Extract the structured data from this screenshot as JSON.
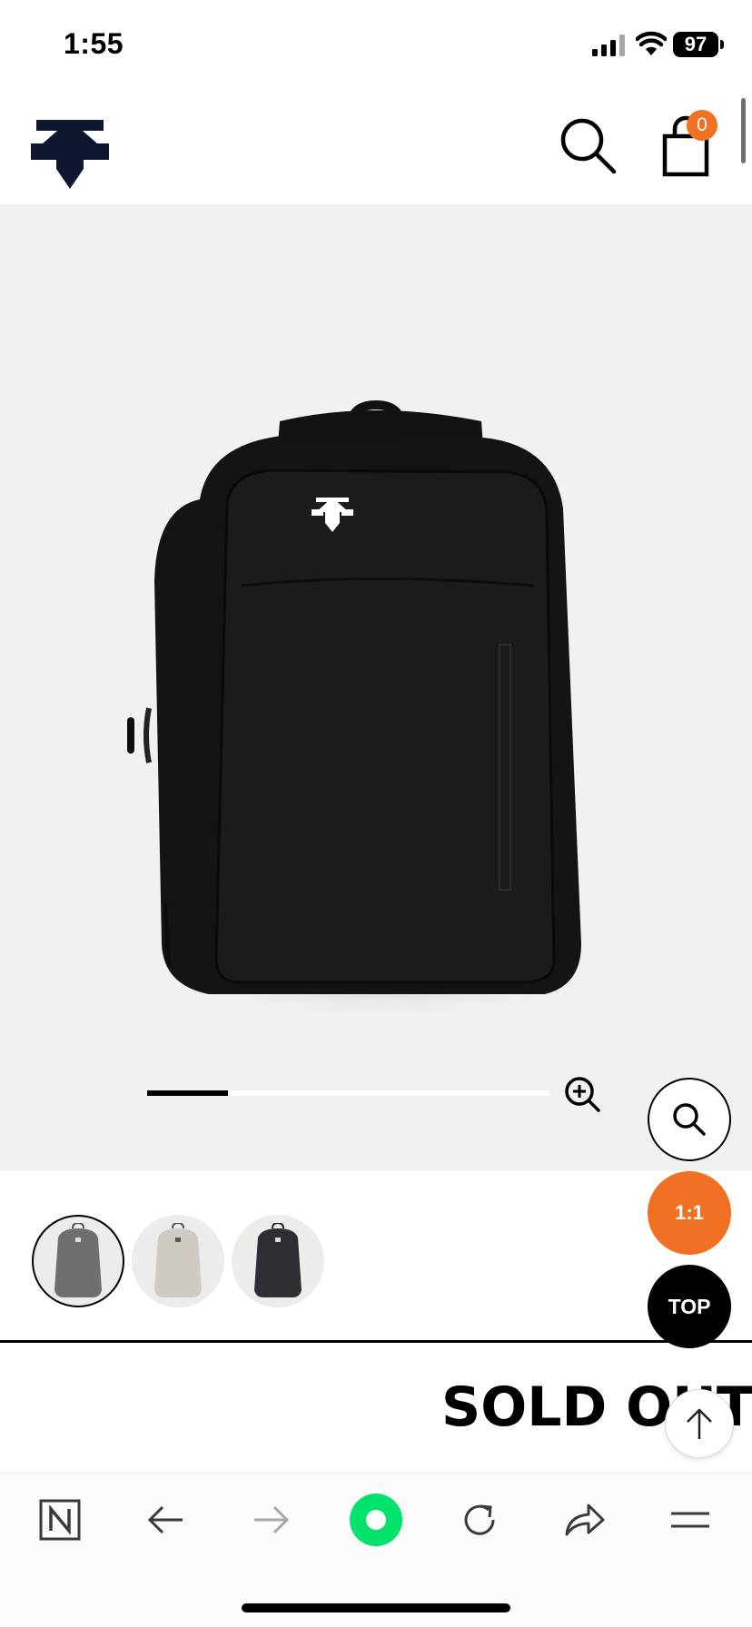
{
  "status_bar": {
    "time": "1:55",
    "battery": "97",
    "icons": [
      "signal-icon",
      "wifi-icon",
      "battery-icon"
    ]
  },
  "header": {
    "logo": "descente-logo",
    "cart_count": "0",
    "icons": [
      "search-icon",
      "cart-icon"
    ]
  },
  "product": {
    "image_slider_progress": 0.2,
    "floating_buttons": {
      "ratio_label": "1:1",
      "top_label": "TOP"
    },
    "thumbnails": [
      {
        "color": "#6f6f6f",
        "selected": true
      },
      {
        "color": "#cfcac3",
        "selected": false
      },
      {
        "color": "#2d2f33",
        "selected": false
      }
    ],
    "status": "SOLD OUT"
  },
  "colors": {
    "accent": "#f07024",
    "brand_navy": "#0e1630",
    "background_gray": "#f1f1f1"
  },
  "browser_toolbar": {
    "icons": [
      "naver-home-icon",
      "back-arrow-icon",
      "forward-arrow-icon",
      "green-dot-icon",
      "reload-icon",
      "share-icon",
      "menu-icon"
    ]
  }
}
